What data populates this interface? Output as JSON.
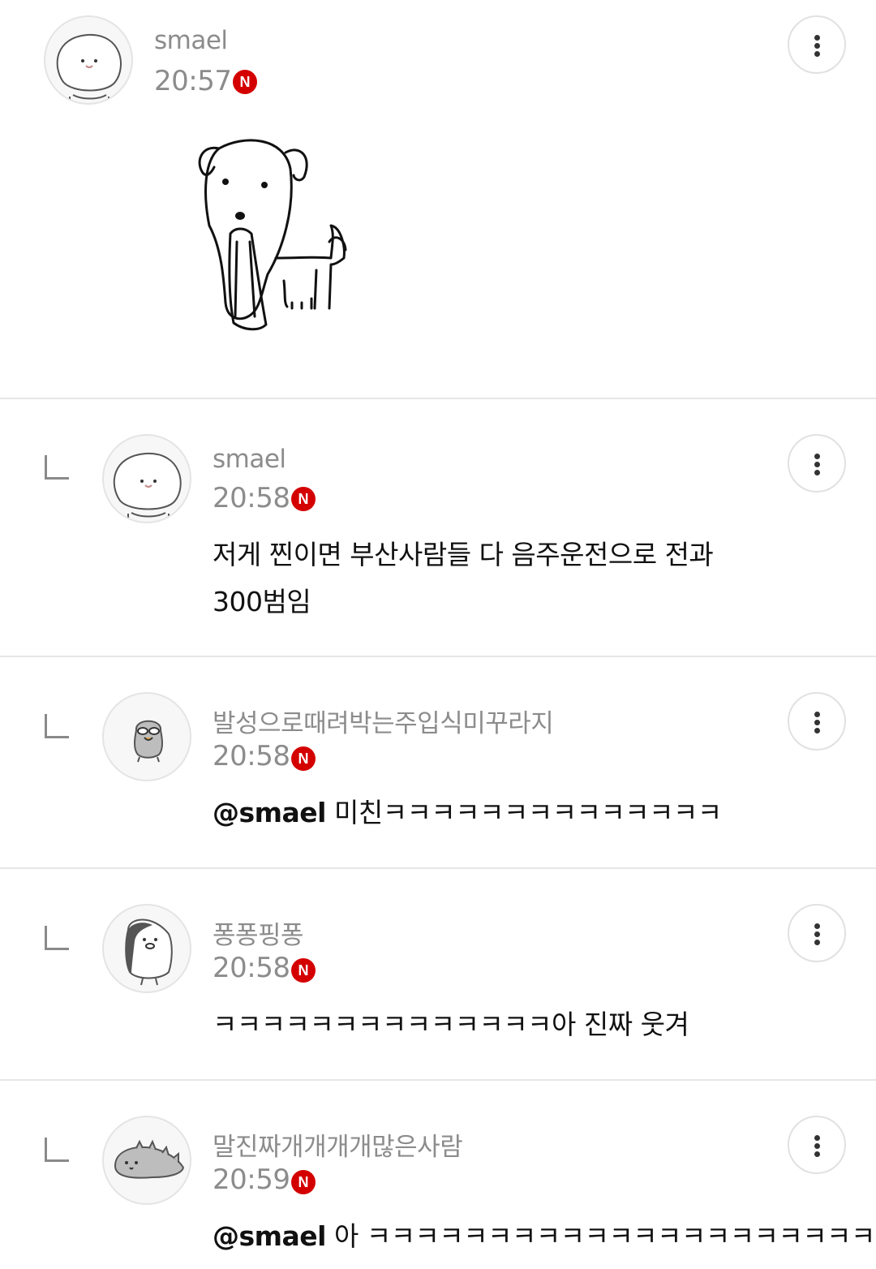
{
  "comments": [
    {
      "nickname": "smael",
      "time": "20:57",
      "new_badge": "N",
      "attachment": "hand-drawn dog sketch",
      "text": ""
    },
    {
      "nickname": "smael",
      "time": "20:58",
      "new_badge": "N",
      "text_line1": "저게 찐이면 부산사람들 다 음주운전으로 전과",
      "text_line2": "300범임"
    },
    {
      "nickname": "발성으로때려박는주입식미꾸라지",
      "time": "20:58",
      "new_badge": "N",
      "mention": "@smael",
      "text": " 미친ㅋㅋㅋㅋㅋㅋㅋㅋㅋㅋㅋㅋㅋㅋ"
    },
    {
      "nickname": "퐁퐁핑퐁",
      "time": "20:58",
      "new_badge": "N",
      "text": "ㅋㅋㅋㅋㅋㅋㅋㅋㅋㅋㅋㅋㅋㅋ아 진짜 웃겨"
    },
    {
      "nickname": "말진짜개개개개많은사람",
      "time": "20:59",
      "new_badge": "N",
      "mention": "@smael",
      "text": " 아 ㅋㅋㅋㅋㅋㅋㅋㅋㅋㅋㅋㅋㅋㅋㅋㅋㅋㅋㅋㅋㅋㅋ"
    }
  ],
  "colors": {
    "meta_gray": "#8c8c8c",
    "badge_red": "#d40000",
    "divider": "#e6e6e6"
  },
  "icons": {
    "more": "vertical-ellipsis-icon",
    "reply": "reply-corner-icon"
  }
}
